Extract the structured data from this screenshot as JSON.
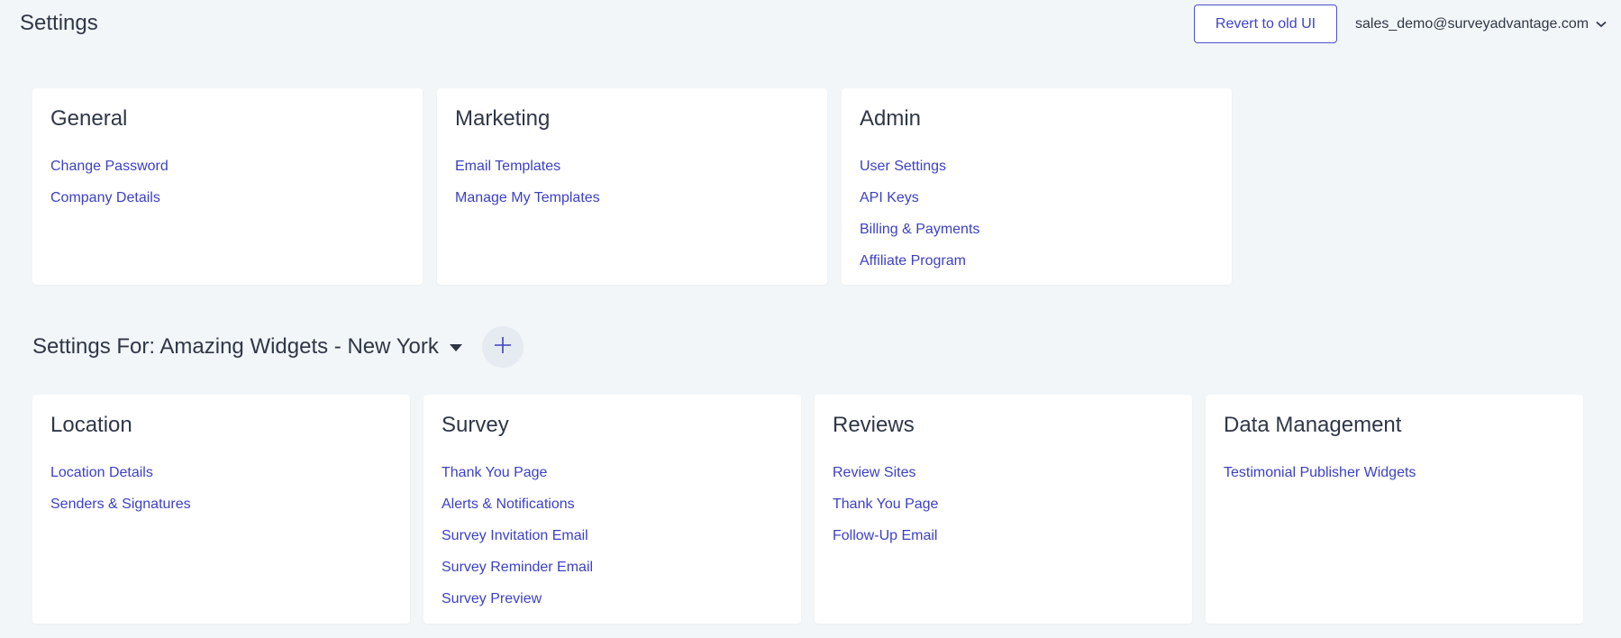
{
  "header": {
    "title": "Settings",
    "revert_label": "Revert to old UI",
    "user_email": "sales_demo@surveyadvantage.com"
  },
  "top_cards": {
    "general": {
      "title": "General",
      "links": [
        "Change Password",
        "Company Details"
      ]
    },
    "marketing": {
      "title": "Marketing",
      "links": [
        "Email Templates",
        "Manage My Templates"
      ]
    },
    "admin": {
      "title": "Admin",
      "links": [
        "User Settings",
        "API Keys",
        "Billing & Payments",
        "Affiliate Program"
      ]
    }
  },
  "location_section": {
    "title": "Settings For: Amazing Widgets - New York"
  },
  "bottom_cards": {
    "location": {
      "title": "Location",
      "links": [
        "Location Details",
        "Senders & Signatures"
      ]
    },
    "survey": {
      "title": "Survey",
      "links": [
        "Thank You Page",
        "Alerts & Notifications",
        "Survey Invitation Email",
        "Survey Reminder Email",
        "Survey Preview"
      ]
    },
    "reviews": {
      "title": "Reviews",
      "links": [
        "Review Sites",
        "Thank You Page",
        "Follow-Up Email"
      ]
    },
    "data_management": {
      "title": "Data Management",
      "links": [
        "Testimonial Publisher Widgets"
      ]
    }
  },
  "icons": {
    "user_menu": "chevron-down-icon",
    "location_dropdown": "caret-down-icon",
    "add_location": "plus-icon"
  },
  "colors": {
    "background": "#f3f6f9",
    "card": "#ffffff",
    "link": "#3d41c1",
    "text": "#2f3747",
    "button_border": "#4a4fc4",
    "add_button_bg": "#e6ebf2"
  }
}
